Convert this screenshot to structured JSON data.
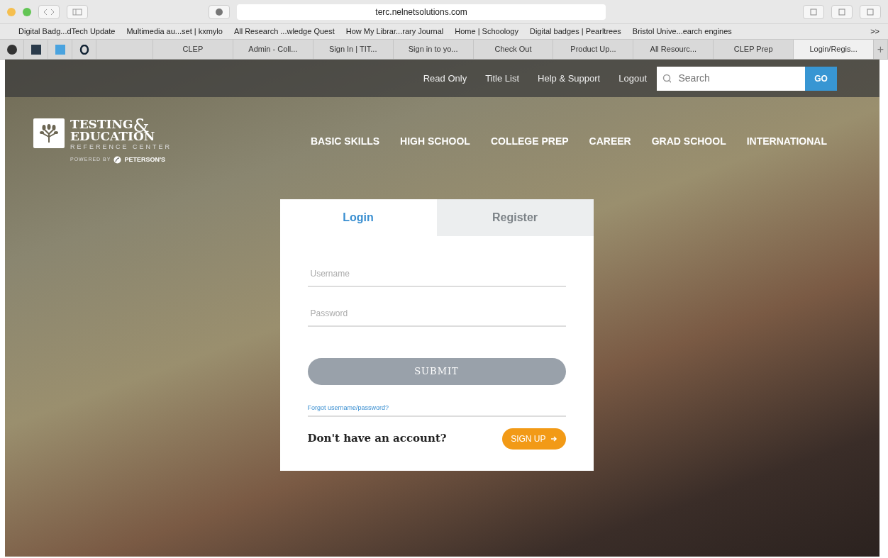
{
  "browser": {
    "address": "terc.nelnetsolutions.com",
    "bookmarks": [
      "Digital Badg...dTech Update",
      "Multimedia au...set | kxmylo",
      "All Research ...wledge Quest",
      "How My Librar...rary Journal",
      "Home | Schoology",
      "Digital badges | Pearltrees",
      "Bristol Unive...earch engines"
    ],
    "bookmarks_more": ">>",
    "tabs": [
      {
        "label": "CLEP",
        "selected": false
      },
      {
        "label": "Admin - Coll...",
        "selected": false
      },
      {
        "label": "Sign In | TIT...",
        "selected": false
      },
      {
        "label": "Sign in to yo...",
        "selected": false
      },
      {
        "label": "Check Out",
        "selected": false
      },
      {
        "label": "Product Up...",
        "selected": false
      },
      {
        "label": "All Resourc...",
        "selected": false
      },
      {
        "label": "CLEP Prep",
        "selected": false
      },
      {
        "label": "Login/Regis...",
        "selected": true
      }
    ],
    "new_tab": "+"
  },
  "header": {
    "utility_links": [
      "Read Only",
      "Title List",
      "Help & Support",
      "Logout"
    ],
    "search": {
      "placeholder": "Search",
      "button": "GO"
    },
    "logo": {
      "line_1": "TESTING",
      "ampersand": "&",
      "line_2": "EDUCATION",
      "line_3": "REFERENCE CENTER",
      "powered_by": "POWERED BY",
      "brand": "PETERSON'S"
    },
    "nav": [
      "BASIC SKILLS",
      "HIGH SCHOOL",
      "COLLEGE PREP",
      "CAREER",
      "GRAD SCHOOL",
      "INTERNATIONAL"
    ]
  },
  "login": {
    "tabs": [
      {
        "label": "Login",
        "selected": true
      },
      {
        "label": "Register",
        "selected": false
      }
    ],
    "username": {
      "placeholder": "Username"
    },
    "password": {
      "placeholder": "Password"
    },
    "submit": "SUBMIT",
    "forgot": "Forgot username/password?",
    "prompt": "Don't have an account?",
    "signup": "SIGN UP"
  }
}
